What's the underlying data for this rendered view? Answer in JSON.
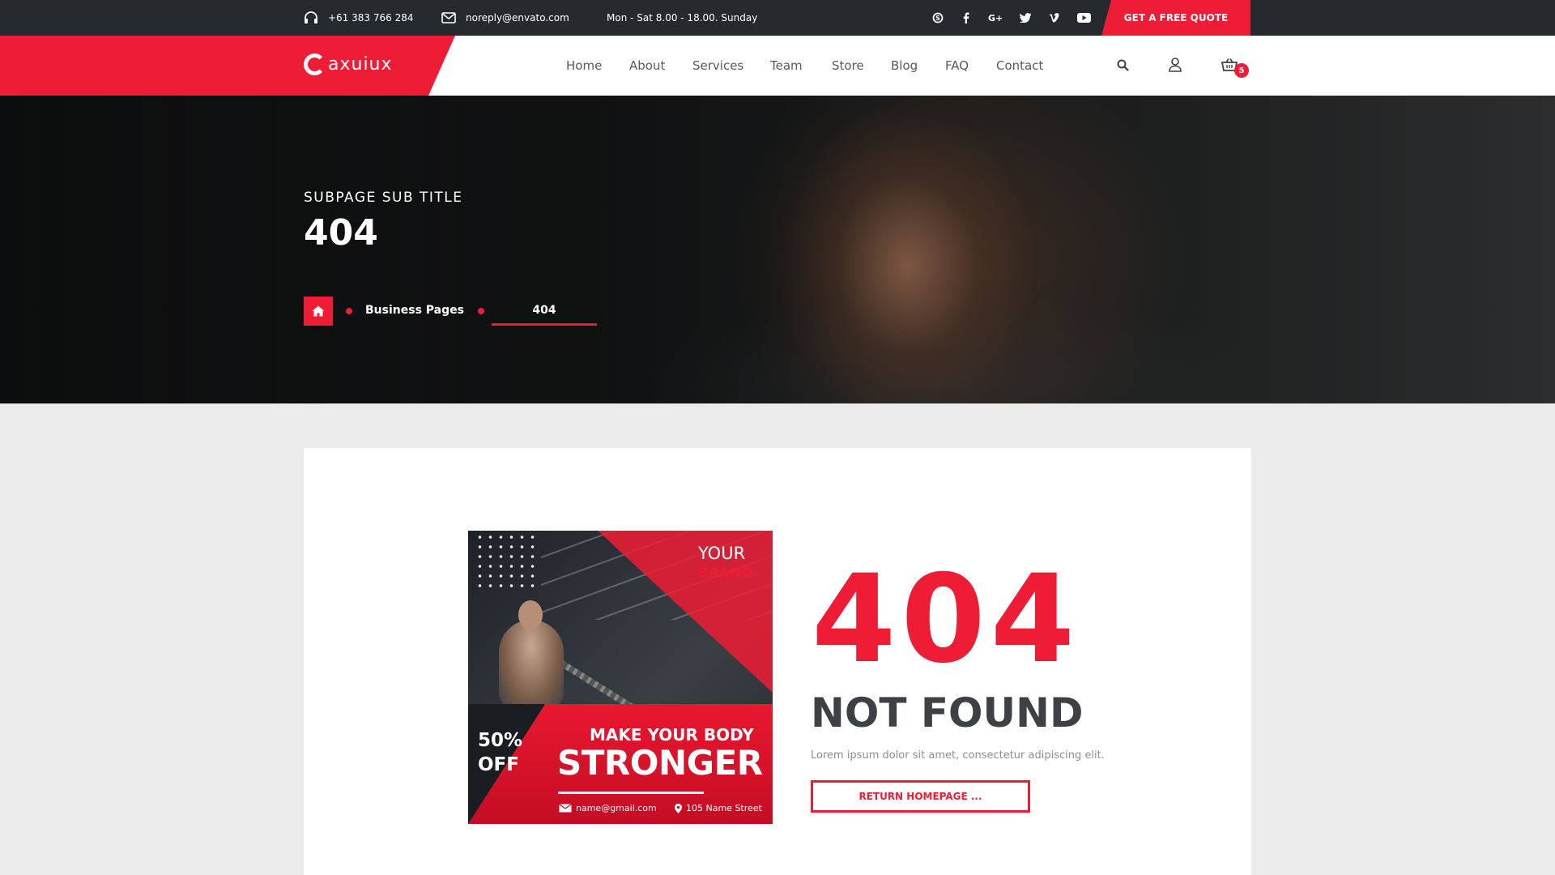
{
  "topbar": {
    "phone": "+61 383 766 284",
    "email": "noreply@envato.com",
    "hours": "Mon - Sat 8.00 - 18.00. Sunday",
    "social": [
      "skype-icon",
      "facebook-icon",
      "google-plus-icon",
      "twitter-icon",
      "vimeo-icon",
      "youtube-icon"
    ],
    "quote_button": "GET A FREE QUOTE"
  },
  "header": {
    "logo_text": "axuiux",
    "nav": [
      "Home",
      "About",
      "Services",
      "Team",
      "Store",
      "Blog",
      "FAQ",
      "Contact"
    ],
    "cart_count": "5"
  },
  "hero": {
    "subtitle": "SUBPAGE SUB TITLE",
    "title": "404",
    "breadcrumb": {
      "parent": "Business Pages",
      "current": "404"
    }
  },
  "promo": {
    "your": "YOUR",
    "brand": "BRAND",
    "discount_pct": "50%",
    "discount_label": "OFF",
    "headline": "MAKE YOUR BODY",
    "headline_big": "STRONGER",
    "email": "name@gmail.com",
    "address": "105 Name Street"
  },
  "error": {
    "code": "404",
    "heading": "NOT FOUND",
    "text": "Lorem ipsum dolor sit amet, consectetur adipiscing elit.",
    "button": "RETURN HOMEPAGE ..."
  },
  "colors": {
    "accent": "#ee1c35",
    "topbar_bg": "#252a2e",
    "heading_dark": "#3d4146"
  }
}
